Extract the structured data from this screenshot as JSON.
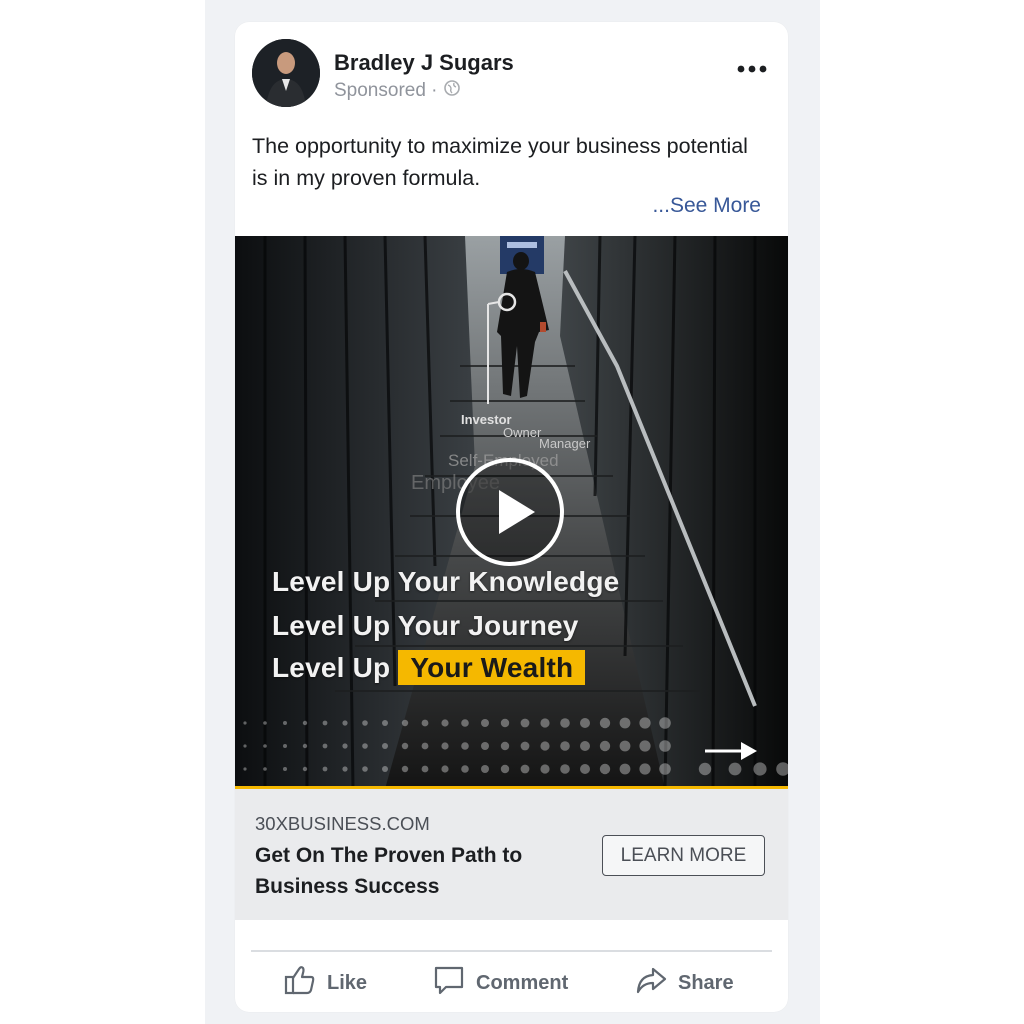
{
  "post": {
    "author": "Bradley J Sugars",
    "sponsored": "Sponsored ·",
    "text": "The opportunity to maximize your business potential is in my proven formula.",
    "see_more": "...See More"
  },
  "media": {
    "ladder_labels": [
      "Investor",
      "Owner",
      "Manager",
      "Self-Employed",
      "Employee"
    ],
    "overlay_line1": "Level Up Your Knowledge",
    "overlay_line2": "Level Up Your Journey",
    "overlay_line3_prefix": "Level Up",
    "overlay_line3_highlight": "Your Wealth",
    "highlight_color": "#f5b800"
  },
  "link": {
    "domain": "30XBUSINESS.COM",
    "title": "Get On The Proven Path to Business Success",
    "cta": "LEARN MORE"
  },
  "actions": {
    "like": "Like",
    "comment": "Comment",
    "share": "Share"
  },
  "icons": {
    "more": "more-options-icon",
    "globe": "globe-icon",
    "play": "play-icon",
    "like": "thumbs-up-icon",
    "comment": "comment-icon",
    "share": "share-icon"
  }
}
